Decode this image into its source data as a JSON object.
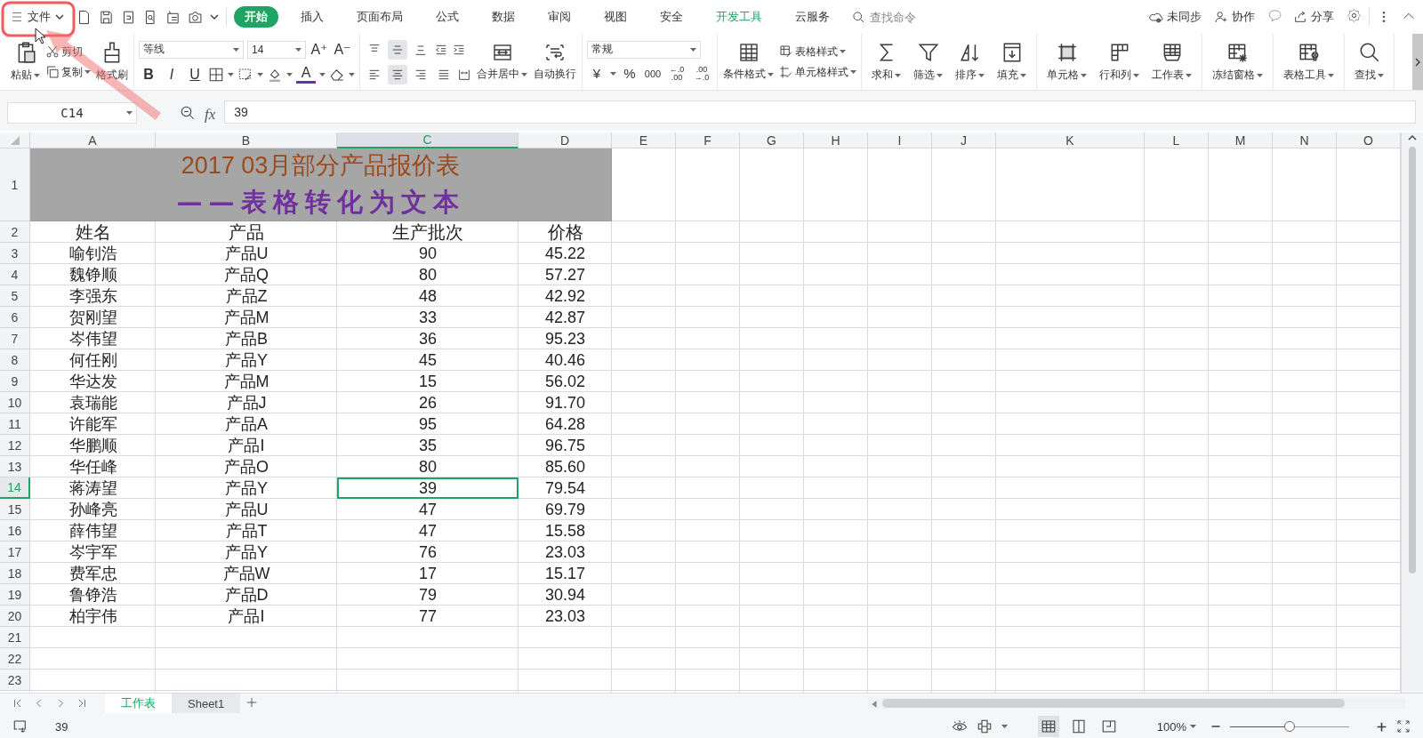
{
  "menu": {
    "label": "文件"
  },
  "tabs": [
    {
      "label": "开始",
      "selected": true,
      "accent": false
    },
    {
      "label": "插入",
      "selected": false,
      "accent": false
    },
    {
      "label": "页面布局",
      "selected": false,
      "accent": false
    },
    {
      "label": "公式",
      "selected": false,
      "accent": false
    },
    {
      "label": "数据",
      "selected": false,
      "accent": false
    },
    {
      "label": "审阅",
      "selected": false,
      "accent": false
    },
    {
      "label": "视图",
      "selected": false,
      "accent": false
    },
    {
      "label": "安全",
      "selected": false,
      "accent": false
    },
    {
      "label": "开发工具",
      "selected": false,
      "accent": true
    },
    {
      "label": "云服务",
      "selected": false,
      "accent": false
    }
  ],
  "command_search": {
    "placeholder": "查找命令"
  },
  "account_actions": [
    "未同步",
    "协作",
    "分享"
  ],
  "ribbon": {
    "paste": "粘贴",
    "cut": "剪切",
    "copy": "复制",
    "format_painter": "格式刷",
    "font_name": "等线",
    "font_size": "14",
    "size_buttons": [
      "A⁺",
      "A⁻"
    ],
    "style_buttons": [
      "B",
      "I",
      "U"
    ],
    "font_color": "A",
    "vertical_align": [
      {
        "selected": false
      },
      {
        "selected": true
      },
      {
        "selected": false
      }
    ],
    "horizontal_align": [
      {
        "selected": false
      },
      {
        "selected": true
      },
      {
        "selected": false
      },
      {
        "selected": false
      }
    ],
    "merge": "合并居中",
    "wrap": "自动换行",
    "number_format": "常规",
    "number_buttons": [
      "¥",
      "%",
      "000"
    ],
    "decimal_buttons": [
      {
        "top": "←.0",
        "bottom": ".00"
      },
      {
        "top": ".00",
        "bottom": "→.0"
      }
    ],
    "conditional_format": "条件格式",
    "table_style": "表格样式",
    "cell_style": "单元格样式",
    "tool_groups": [
      [
        {
          "label": "求和",
          "dropdown": true
        },
        {
          "label": "筛选",
          "dropdown": true
        },
        {
          "label": "排序",
          "dropdown": true
        },
        {
          "label": "填充",
          "dropdown": true
        }
      ],
      [
        {
          "label": "单元格",
          "dropdown": true
        },
        {
          "label": "行和列",
          "dropdown": true
        },
        {
          "label": "工作表",
          "dropdown": true
        }
      ],
      [
        {
          "label": "冻结窗格",
          "dropdown": true
        }
      ],
      [
        {
          "label": "表格工具",
          "dropdown": true
        }
      ],
      [
        {
          "label": "查找",
          "dropdown": true
        }
      ]
    ]
  },
  "formula_bar": {
    "cell_ref": "C14",
    "function_label": "fx",
    "value": "39"
  },
  "sheet": {
    "columns": [
      {
        "label": "A",
        "selected": false
      },
      {
        "label": "B",
        "selected": false
      },
      {
        "label": "C",
        "selected": true
      },
      {
        "label": "D",
        "selected": false
      },
      {
        "label": "E",
        "selected": false
      },
      {
        "label": "F",
        "selected": false
      },
      {
        "label": "G",
        "selected": false
      },
      {
        "label": "H",
        "selected": false
      },
      {
        "label": "I",
        "selected": false
      },
      {
        "label": "J",
        "selected": false
      },
      {
        "label": "K",
        "selected": false
      },
      {
        "label": "L",
        "selected": false
      },
      {
        "label": "M",
        "selected": false
      },
      {
        "label": "N",
        "selected": false
      },
      {
        "label": "O",
        "selected": false
      }
    ],
    "rows": [
      {
        "number": "1",
        "selected": false,
        "kind": "title",
        "lines": [
          "2017 03月部分产品报价表",
          "——表格转化为文本"
        ]
      },
      {
        "number": "2",
        "selected": false,
        "kind": "header",
        "cells": [
          "姓名",
          "产品",
          "生产批次",
          "价格"
        ]
      },
      {
        "number": "3",
        "selected": false,
        "kind": "data",
        "cells": [
          "喻钊浩",
          "产品U",
          "90",
          "45.22"
        ]
      },
      {
        "number": "4",
        "selected": false,
        "kind": "data",
        "cells": [
          "魏铮顺",
          "产品Q",
          "80",
          "57.27"
        ]
      },
      {
        "number": "5",
        "selected": false,
        "kind": "data",
        "cells": [
          "李强东",
          "产品Z",
          "48",
          "42.92"
        ]
      },
      {
        "number": "6",
        "selected": false,
        "kind": "data",
        "cells": [
          "贺刚望",
          "产品M",
          "33",
          "42.87"
        ]
      },
      {
        "number": "7",
        "selected": false,
        "kind": "data",
        "cells": [
          "岑伟望",
          "产品B",
          "36",
          "95.23"
        ]
      },
      {
        "number": "8",
        "selected": false,
        "kind": "data",
        "cells": [
          "何任刚",
          "产品Y",
          "45",
          "40.46"
        ]
      },
      {
        "number": "9",
        "selected": false,
        "kind": "data",
        "cells": [
          "华达发",
          "产品M",
          "15",
          "56.02"
        ]
      },
      {
        "number": "10",
        "selected": false,
        "kind": "data",
        "cells": [
          "袁瑞能",
          "产品J",
          "26",
          "91.70"
        ]
      },
      {
        "number": "11",
        "selected": false,
        "kind": "data",
        "cells": [
          "许能军",
          "产品A",
          "95",
          "64.28"
        ]
      },
      {
        "number": "12",
        "selected": false,
        "kind": "data",
        "cells": [
          "华鹏顺",
          "产品I",
          "35",
          "96.75"
        ]
      },
      {
        "number": "13",
        "selected": false,
        "kind": "data",
        "cells": [
          "华任峰",
          "产品O",
          "80",
          "85.60"
        ]
      },
      {
        "number": "14",
        "selected": true,
        "kind": "data",
        "cells": [
          "蒋涛望",
          "产品Y",
          "39",
          "79.54"
        ]
      },
      {
        "number": "15",
        "selected": false,
        "kind": "data",
        "cells": [
          "孙峰亮",
          "产品U",
          "47",
          "69.79"
        ]
      },
      {
        "number": "16",
        "selected": false,
        "kind": "data",
        "cells": [
          "薛伟望",
          "产品T",
          "47",
          "15.58"
        ]
      },
      {
        "number": "17",
        "selected": false,
        "kind": "data",
        "cells": [
          "岑宇军",
          "产品Y",
          "76",
          "23.03"
        ]
      },
      {
        "number": "18",
        "selected": false,
        "kind": "data",
        "cells": [
          "费军忠",
          "产品W",
          "17",
          "15.17"
        ]
      },
      {
        "number": "19",
        "selected": false,
        "kind": "data",
        "cells": [
          "鲁铮浩",
          "产品D",
          "79",
          "30.94"
        ]
      },
      {
        "number": "20",
        "selected": false,
        "kind": "data",
        "cells": [
          "柏宇伟",
          "产品I",
          "77",
          "23.03"
        ]
      },
      {
        "number": "21",
        "selected": false,
        "kind": "empty"
      },
      {
        "number": "22",
        "selected": false,
        "kind": "empty"
      },
      {
        "number": "23",
        "selected": false,
        "kind": "empty"
      }
    ]
  },
  "sheet_tabs": [
    {
      "label": "工作表",
      "selected": true
    },
    {
      "label": "Sheet1",
      "selected": false
    }
  ],
  "status_bar": {
    "cell_value": "39",
    "views": [
      {
        "selected": true
      },
      {
        "selected": false
      },
      {
        "selected": false
      }
    ],
    "zoom": {
      "label": "100%",
      "level": 0.5
    }
  }
}
